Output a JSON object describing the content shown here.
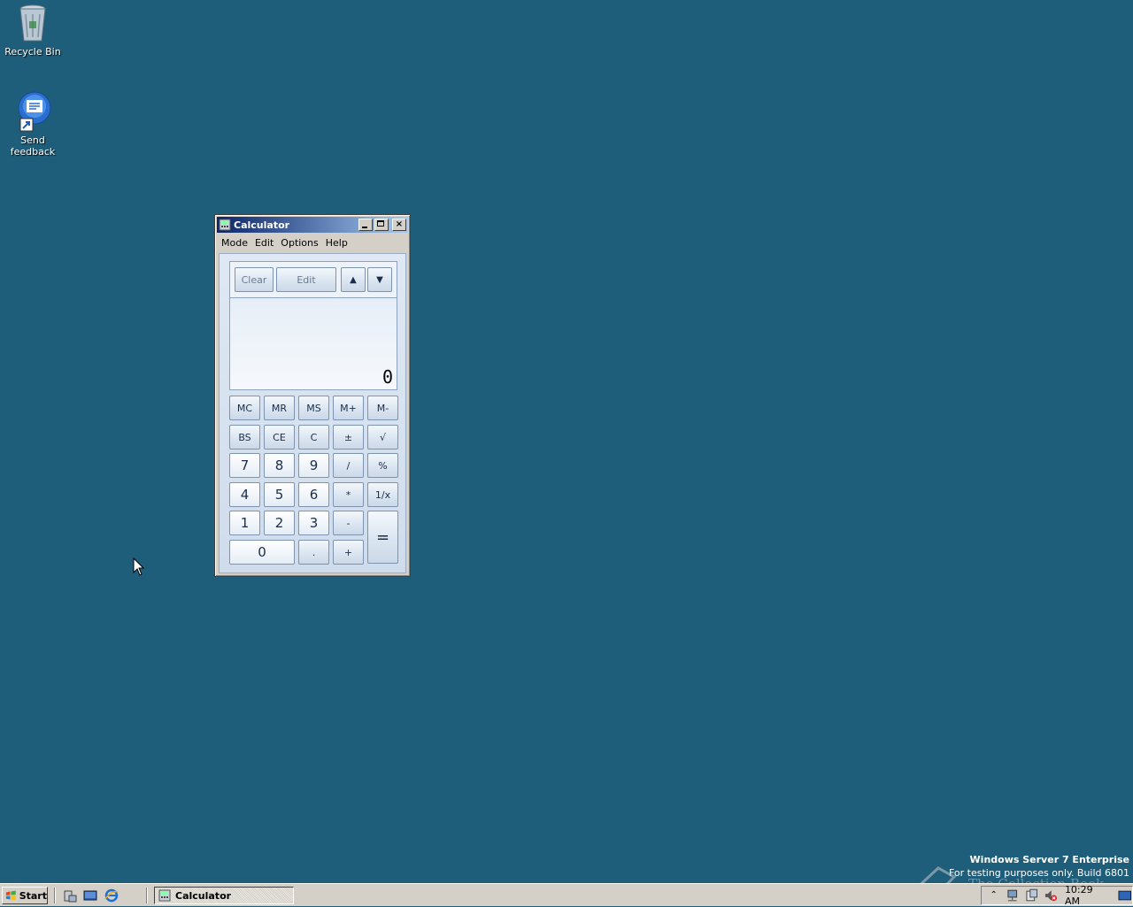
{
  "desktop": {
    "icons": [
      {
        "label": "Recycle Bin",
        "icon": "recycle-bin-icon"
      },
      {
        "label": "Send feedback",
        "icon": "feedback-icon"
      }
    ]
  },
  "calculator": {
    "title": "Calculator",
    "menu": [
      "Mode",
      "Edit",
      "Options",
      "Help"
    ],
    "history_buttons": {
      "clear": "Clear",
      "edit": "Edit"
    },
    "display_value": "0",
    "buttons": {
      "mc": "MC",
      "mr": "MR",
      "ms": "MS",
      "mplus": "M+",
      "mminus": "M-",
      "bs": "BS",
      "ce": "CE",
      "c": "C",
      "plusminus": "±",
      "sqrt": "√",
      "n7": "7",
      "n8": "8",
      "n9": "9",
      "div": "/",
      "pct": "%",
      "n4": "4",
      "n5": "5",
      "n6": "6",
      "mul": "*",
      "recip": "1/x",
      "n1": "1",
      "n2": "2",
      "n3": "3",
      "sub": "-",
      "n0": "0",
      "dot": ".",
      "add": "+",
      "eq": "="
    }
  },
  "taskbar": {
    "start_label": "Start",
    "task_label": "Calculator",
    "clock": "10:29 AM"
  },
  "watermark": {
    "line1": "Windows Server 7 Enterprise",
    "line2": "For testing purposes only. Build 6801",
    "overlay": "The Collection Book"
  }
}
